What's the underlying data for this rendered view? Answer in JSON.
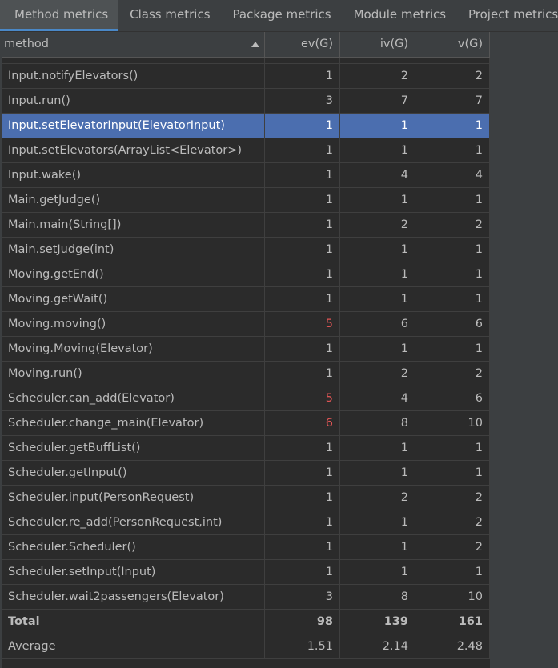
{
  "tabs": [
    {
      "label": "Method metrics",
      "active": true
    },
    {
      "label": "Class metrics",
      "active": false
    },
    {
      "label": "Package metrics",
      "active": false
    },
    {
      "label": "Module metrics",
      "active": false
    },
    {
      "label": "Project metrics",
      "active": false
    }
  ],
  "table": {
    "columns": [
      "method",
      "ev(G)",
      "iv(G)",
      "v(G)"
    ],
    "sort_icon": "sort-ascending-icon",
    "rows": [
      {
        "method": "Input.notifyElevators()",
        "ev": "1",
        "iv": "2",
        "v": "2"
      },
      {
        "method": "Input.run()",
        "ev": "3",
        "iv": "7",
        "v": "7"
      },
      {
        "method": "Input.setElevatorInput(ElevatorInput)",
        "ev": "1",
        "iv": "1",
        "v": "1",
        "selected": true
      },
      {
        "method": "Input.setElevators(ArrayList<Elevator>)",
        "ev": "1",
        "iv": "1",
        "v": "1"
      },
      {
        "method": "Input.wake()",
        "ev": "1",
        "iv": "4",
        "v": "4"
      },
      {
        "method": "Main.getJudge()",
        "ev": "1",
        "iv": "1",
        "v": "1"
      },
      {
        "method": "Main.main(String[])",
        "ev": "1",
        "iv": "2",
        "v": "2"
      },
      {
        "method": "Main.setJudge(int)",
        "ev": "1",
        "iv": "1",
        "v": "1"
      },
      {
        "method": "Moving.getEnd()",
        "ev": "1",
        "iv": "1",
        "v": "1"
      },
      {
        "method": "Moving.getWait()",
        "ev": "1",
        "iv": "1",
        "v": "1"
      },
      {
        "method": "Moving.moving()",
        "ev": "5",
        "iv": "6",
        "v": "6",
        "ev_flag": true
      },
      {
        "method": "Moving.Moving(Elevator)",
        "ev": "1",
        "iv": "1",
        "v": "1"
      },
      {
        "method": "Moving.run()",
        "ev": "1",
        "iv": "2",
        "v": "2"
      },
      {
        "method": "Scheduler.can_add(Elevator)",
        "ev": "5",
        "iv": "4",
        "v": "6",
        "ev_flag": true
      },
      {
        "method": "Scheduler.change_main(Elevator)",
        "ev": "6",
        "iv": "8",
        "v": "10",
        "ev_flag": true
      },
      {
        "method": "Scheduler.getBuffList()",
        "ev": "1",
        "iv": "1",
        "v": "1"
      },
      {
        "method": "Scheduler.getInput()",
        "ev": "1",
        "iv": "1",
        "v": "1"
      },
      {
        "method": "Scheduler.input(PersonRequest)",
        "ev": "1",
        "iv": "2",
        "v": "2"
      },
      {
        "method": "Scheduler.re_add(PersonRequest,int)",
        "ev": "1",
        "iv": "1",
        "v": "2"
      },
      {
        "method": "Scheduler.Scheduler()",
        "ev": "1",
        "iv": "1",
        "v": "2"
      },
      {
        "method": "Scheduler.setInput(Input)",
        "ev": "1",
        "iv": "1",
        "v": "1"
      },
      {
        "method": "Scheduler.wait2passengers(Elevator)",
        "ev": "3",
        "iv": "8",
        "v": "10"
      }
    ],
    "total": {
      "method": "Total",
      "ev": "98",
      "iv": "139",
      "v": "161"
    },
    "average": {
      "method": "Average",
      "ev": "1.51",
      "iv": "2.14",
      "v": "2.48"
    }
  },
  "colors": {
    "background": "#3c3f41",
    "table_bg": "#2b2b2b",
    "selection": "#4b6eaf",
    "warning_text": "#e05555"
  }
}
